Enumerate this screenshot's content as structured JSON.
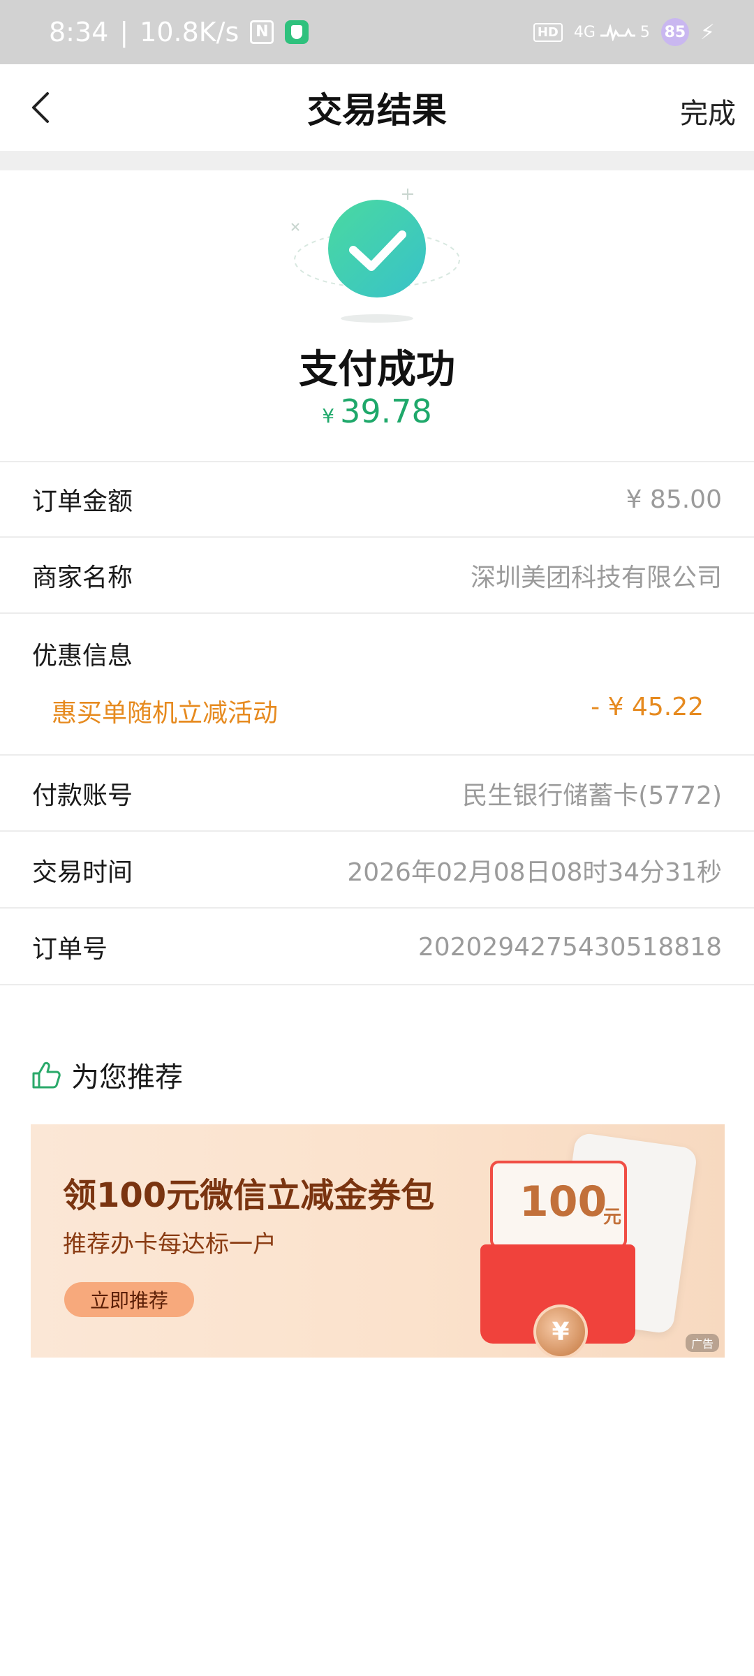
{
  "status_bar": {
    "time": "8:34",
    "network_speed": "10.8K/s",
    "nfc_icon": "nfc-icon",
    "app_badge_icon": "shield-icon",
    "hd_label": "HD",
    "signal_label": "4G",
    "signal_sub": "5",
    "battery_level": "85",
    "charging_icon": "bolt-icon"
  },
  "navbar": {
    "back_icon": "chevron-left-icon",
    "title": "交易结果",
    "done_label": "完成"
  },
  "result": {
    "status_icon": "check-circle-icon",
    "title": "支付成功",
    "currency_symbol": "¥",
    "amount": "39.78",
    "colors": {
      "success": "#1ea86a"
    }
  },
  "details": {
    "order_amount": {
      "label": "订单金额",
      "value": "¥ 85.00"
    },
    "merchant": {
      "label": "商家名称",
      "value": "深圳美团科技有限公司"
    },
    "discount": {
      "label": "优惠信息",
      "name": "惠买单随机立减活动",
      "value": "- ¥ 45.22",
      "color": "#e68a1f"
    },
    "account": {
      "label": "付款账号",
      "value": "民生银行储蓄卡(5772)"
    },
    "time": {
      "label": "交易时间",
      "value": "2026年02月08日08时34分31秒"
    },
    "order_no": {
      "label": "订单号",
      "value": "2020294275430518818"
    }
  },
  "recommend": {
    "icon": "thumbs-up-icon",
    "title": "为您推荐",
    "ad": {
      "headline": "领100元微信立减金券包",
      "subline": "推荐办卡每达标一户",
      "cta": "立即推荐",
      "envelope_amount": "100",
      "envelope_unit": "元",
      "coin_symbol": "¥",
      "tag": "广告"
    }
  }
}
